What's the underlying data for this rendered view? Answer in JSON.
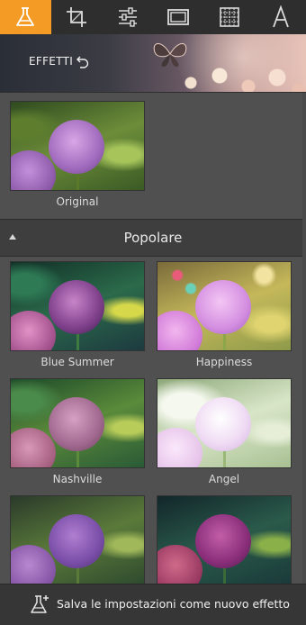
{
  "toolbar": {
    "tools": [
      {
        "icon": "flask-icon",
        "active": true
      },
      {
        "icon": "crop-icon",
        "active": false
      },
      {
        "icon": "sliders-icon",
        "active": false
      },
      {
        "icon": "frame-icon",
        "active": false
      },
      {
        "icon": "texture-icon",
        "active": false
      },
      {
        "icon": "text-icon",
        "active": false,
        "glyph": "A"
      }
    ],
    "accent_color": "#f49b25"
  },
  "banner": {
    "label": "EFFETTI",
    "undo_icon": "undo-icon",
    "decor_icon": "butterfly-icon"
  },
  "original": {
    "label": "Original"
  },
  "section": {
    "title": "Popolare",
    "collapse_icon": "triangle-up-icon"
  },
  "effects": [
    {
      "label": "Blue Summer"
    },
    {
      "label": "Happiness"
    },
    {
      "label": "Nashville"
    },
    {
      "label": "Angel"
    },
    {
      "label": ""
    },
    {
      "label": ""
    }
  ],
  "footer": {
    "save_label": "Salva le impostazioni come nuovo effetto",
    "save_icon": "flask-plus-icon"
  }
}
